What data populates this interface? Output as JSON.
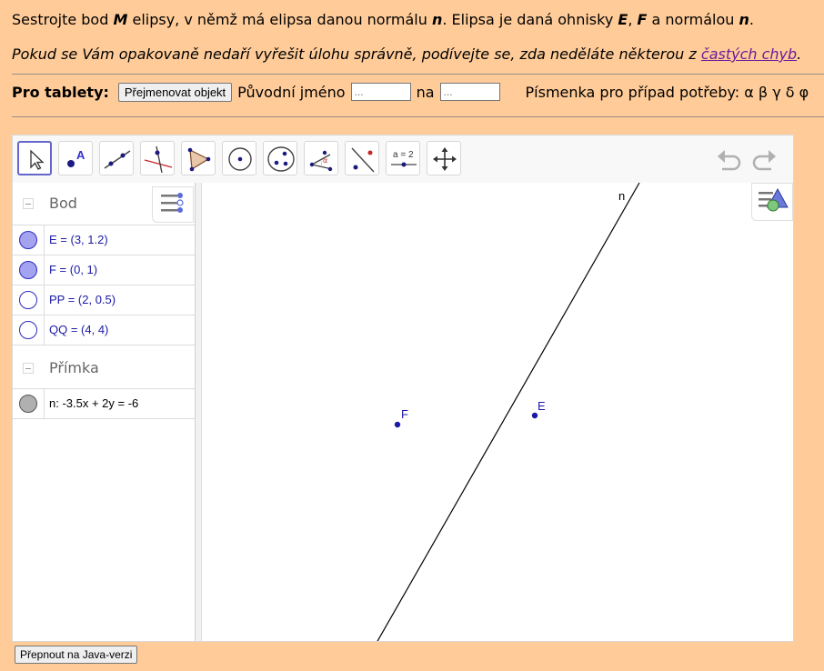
{
  "task": {
    "t1": "Sestrojte bod ",
    "m": "M",
    "t2": " elipsy, v němž má elipsa danou normálu ",
    "n1": "n",
    "t3": ". Elipsa je daná ohnisky ",
    "e": "E",
    "t4": ", ",
    "f": "F",
    "t5": " a normálou ",
    "n2": "n",
    "t6": "."
  },
  "hint": {
    "before": "Pokud se Vám opakovaně nedaří vyřešit úlohu správně, podívejte se, zda neděláte některou z ",
    "link": "častých chyb",
    "after": "."
  },
  "tablet": {
    "label": "Pro tablety:",
    "rename_button": "Přejmenovat objekt",
    "original_name_label": "Původní jméno",
    "original_name_placeholder": "...",
    "to_label": "na",
    "new_name_placeholder": "...",
    "letters": "Písmenka pro případ potřeby: α β γ δ φ"
  },
  "toolbar": {
    "tools": [
      "move-tool",
      "point-tool",
      "line-tool",
      "perpendicular-tool",
      "polygon-tool",
      "circle-tool",
      "conic-tool",
      "angle-tool",
      "reflect-tool",
      "slider-tool",
      "move-graphics-tool"
    ],
    "slider_label": "a = 2"
  },
  "algebra": {
    "categories": [
      {
        "name": "Bod",
        "items": [
          {
            "text": "E = (3, 1.2)",
            "filled": true
          },
          {
            "text": "F = (0, 1)",
            "filled": true
          },
          {
            "text": "PP = (2, 0.5)",
            "filled": false
          },
          {
            "text": "QQ = (4, 4)",
            "filled": false
          }
        ]
      },
      {
        "name": "Přímka",
        "items": [
          {
            "text": "n: -3.5x + 2y = -6",
            "filled": true
          }
        ]
      }
    ]
  },
  "graphics": {
    "labels": {
      "line": "n",
      "e": "E",
      "f": "F"
    },
    "colors": {
      "point": "#1a1aa6",
      "line": "#000000"
    }
  },
  "java_button": "Přepnout na Java-verzi",
  "colors": {
    "page_bg": "#ffcc99",
    "accent": "#6566cc"
  }
}
